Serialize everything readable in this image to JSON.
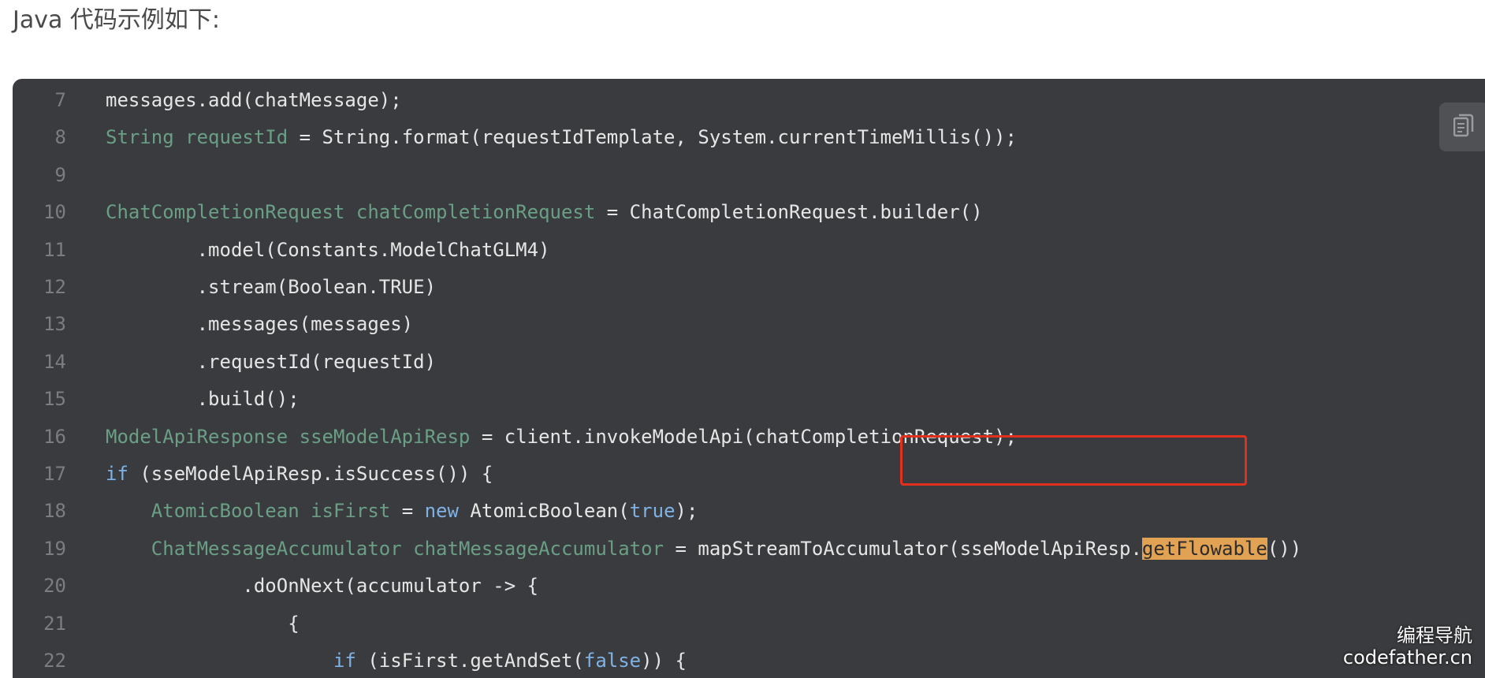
{
  "heading": "Java 代码示例如下:",
  "copy_button_icon": "copy-icon",
  "lines": [
    {
      "n": "7",
      "tokens": [
        {
          "t": "messages.add(chatMessage);",
          "c": ""
        }
      ]
    },
    {
      "n": "8",
      "tokens": [
        {
          "t": "String",
          "c": "type"
        },
        {
          "t": " ",
          "c": ""
        },
        {
          "t": "requestId",
          "c": "var"
        },
        {
          "t": " = String.format(requestIdTemplate, System.currentTimeMillis());",
          "c": ""
        }
      ]
    },
    {
      "n": "9",
      "tokens": [
        {
          "t": "",
          "c": ""
        }
      ]
    },
    {
      "n": "10",
      "tokens": [
        {
          "t": "ChatCompletionRequest",
          "c": "type"
        },
        {
          "t": " ",
          "c": ""
        },
        {
          "t": "chatCompletionRequest",
          "c": "var"
        },
        {
          "t": " = ChatCompletionRequest.builder()",
          "c": ""
        }
      ]
    },
    {
      "n": "11",
      "tokens": [
        {
          "t": "        .model(Constants.ModelChatGLM4)",
          "c": ""
        }
      ]
    },
    {
      "n": "12",
      "tokens": [
        {
          "t": "        .stream(Boolean.TRUE)",
          "c": ""
        }
      ]
    },
    {
      "n": "13",
      "tokens": [
        {
          "t": "        .messages(messages)",
          "c": ""
        }
      ]
    },
    {
      "n": "14",
      "tokens": [
        {
          "t": "        .requestId(requestId)",
          "c": ""
        }
      ]
    },
    {
      "n": "15",
      "tokens": [
        {
          "t": "        .build();",
          "c": ""
        }
      ]
    },
    {
      "n": "16",
      "tokens": [
        {
          "t": "ModelApiResponse",
          "c": "type"
        },
        {
          "t": " ",
          "c": ""
        },
        {
          "t": "sseModelApiResp",
          "c": "var"
        },
        {
          "t": " = client.invokeModelApi(chatCompletionRequest);",
          "c": ""
        }
      ]
    },
    {
      "n": "17",
      "tokens": [
        {
          "t": "if",
          "c": "kw"
        },
        {
          "t": " (sseModelApiResp.isSuccess()) {",
          "c": ""
        }
      ]
    },
    {
      "n": "18",
      "tokens": [
        {
          "t": "    ",
          "c": ""
        },
        {
          "t": "AtomicBoolean",
          "c": "type"
        },
        {
          "t": " ",
          "c": ""
        },
        {
          "t": "isFirst",
          "c": "var"
        },
        {
          "t": " = ",
          "c": ""
        },
        {
          "t": "new",
          "c": "kw"
        },
        {
          "t": " AtomicBoolean(",
          "c": ""
        },
        {
          "t": "true",
          "c": "kw"
        },
        {
          "t": ");",
          "c": ""
        }
      ]
    },
    {
      "n": "19",
      "tokens": [
        {
          "t": "    ",
          "c": ""
        },
        {
          "t": "ChatMessageAccumulator",
          "c": "type"
        },
        {
          "t": " ",
          "c": ""
        },
        {
          "t": "chatMessageAccumulator",
          "c": "var"
        },
        {
          "t": " = mapStreamToAccumulator(sseModelApiResp.",
          "c": ""
        },
        {
          "t": "getFlowable",
          "c": "hl"
        },
        {
          "t": "())",
          "c": ""
        }
      ]
    },
    {
      "n": "20",
      "tokens": [
        {
          "t": "            .doOnNext(accumulator -> {",
          "c": ""
        }
      ]
    },
    {
      "n": "21",
      "tokens": [
        {
          "t": "                {",
          "c": ""
        }
      ]
    },
    {
      "n": "22",
      "tokens": [
        {
          "t": "                    ",
          "c": ""
        },
        {
          "t": "if",
          "c": "kw"
        },
        {
          "t": " (isFirst.getAndSet(",
          "c": ""
        },
        {
          "t": "false",
          "c": "kw"
        },
        {
          "t": ")) {",
          "c": ""
        }
      ]
    }
  ],
  "watermark": {
    "line1": "编程导航",
    "line2": "codefather.cn"
  }
}
